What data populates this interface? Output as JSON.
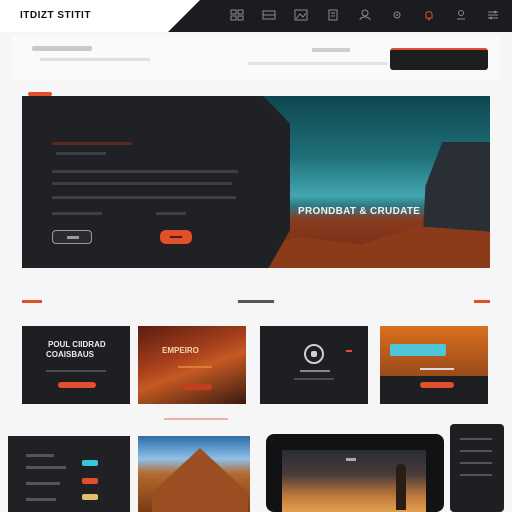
{
  "app": {
    "brand": "ITDIZT STITIT"
  },
  "nav": {
    "icons": [
      "grid-icon",
      "grid-icon",
      "image-icon",
      "document-icon",
      "profile-icon",
      "gear-icon",
      "notification-icon",
      "user-icon",
      "settings-icon"
    ],
    "accent": "#e2502b"
  },
  "hero": {
    "title": "PRONDBAT & CRUDATE"
  },
  "cards": [
    {
      "title": "POUL CIIDRAD",
      "subtitle": "COAISBAUS"
    },
    {
      "title": "EMPEIRO",
      "subtitle": ""
    },
    {
      "title": "",
      "subtitle": ""
    },
    {
      "title": "",
      "subtitle": ""
    }
  ],
  "colors": {
    "accent": "#e2502b",
    "dark": "#1e1f23",
    "teal": "#1e6f78"
  }
}
